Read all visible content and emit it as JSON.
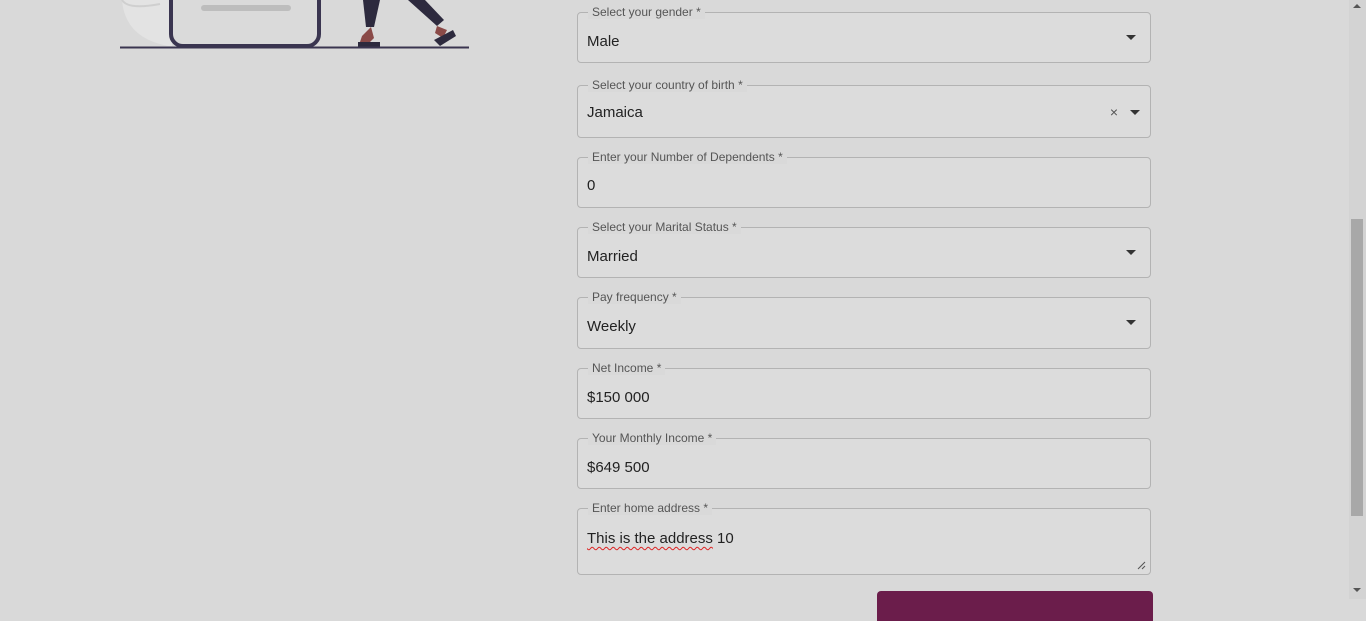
{
  "form": {
    "gender": {
      "label": "Select your gender *",
      "value": "Male"
    },
    "country_of_birth": {
      "label": "Select your country of birth *",
      "value": "Jamaica",
      "clear_glyph": "×"
    },
    "dependents": {
      "label": "Enter your Number of Dependents *",
      "value": "0"
    },
    "marital_status": {
      "label": "Select your Marital Status *",
      "value": "Married"
    },
    "pay_frequency": {
      "label": "Pay frequency *",
      "value": "Weekly"
    },
    "net_income": {
      "label": "Net Income *",
      "value": "$150 000"
    },
    "monthly_income": {
      "label": "Your Monthly Income *",
      "value": "$649 500"
    },
    "home_address": {
      "label": "Enter home address *",
      "value_misspelled": "This is the address",
      "value_rest": " 10"
    }
  },
  "colors": {
    "page_bg": "#d9d9d9",
    "submit_button": "#6b1d4b",
    "illustration_dark": "#3a3550",
    "skin": "#8a4a48"
  },
  "icons": [
    "dropdown-caret-icon",
    "clear-icon",
    "resize-handle-icon"
  ]
}
